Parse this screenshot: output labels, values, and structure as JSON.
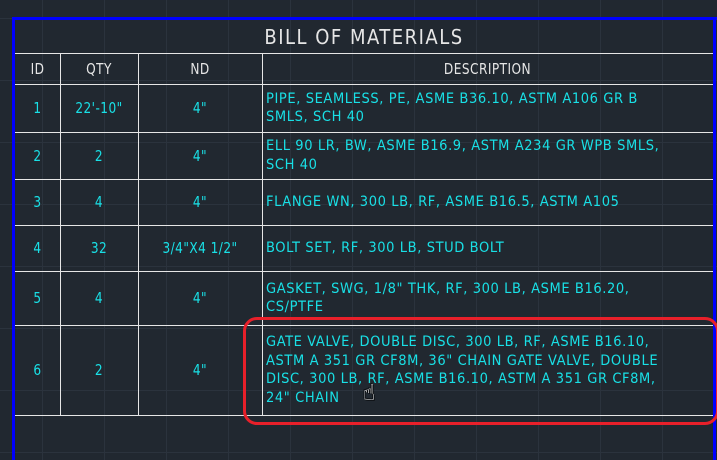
{
  "table": {
    "title": "BILL OF MATERIALS",
    "headers": [
      "ID",
      "QTY",
      "ND",
      "DESCRIPTION"
    ],
    "rows": [
      {
        "id": "1",
        "qty": "22'-10\"",
        "nd": "4\"",
        "desc": "PIPE, SEAMLESS, PE, ASME B36.10, ASTM A106 GR B\nSMLS, SCH 40"
      },
      {
        "id": "2",
        "qty": "2",
        "nd": "4\"",
        "desc": "ELL 90 LR, BW, ASME B16.9, ASTM A234 GR WPB SMLS,\nSCH 40"
      },
      {
        "id": "3",
        "qty": "4",
        "nd": "4\"",
        "desc": "FLANGE WN, 300 LB, RF, ASME B16.5, ASTM A105"
      },
      {
        "id": "4",
        "qty": "32",
        "nd": "3/4\"X4 1/2\"",
        "desc": "BOLT SET, RF, 300 LB, STUD BOLT"
      },
      {
        "id": "5",
        "qty": "4",
        "nd": "4\"",
        "desc": "GASKET, SWG, 1/8\" THK, RF, 300 LB, ASME B16.20,\nCS/PTFE"
      },
      {
        "id": "6",
        "qty": "2",
        "nd": "4\"",
        "desc": "GATE VALVE, DOUBLE DISC, 300 LB, RF, ASME B16.10,\nASTM A 351 GR CF8M, 36\" CHAIN GATE VALVE, DOUBLE\nDISC, 300 LB, RF, ASME B16.10, ASTM A 351 GR CF8M,\n24\" CHAIN"
      }
    ]
  },
  "colors": {
    "text": "#19e0e6",
    "border": "#0000ff",
    "highlight": "#e8202a"
  },
  "cursor_icon": "hand-pointer"
}
